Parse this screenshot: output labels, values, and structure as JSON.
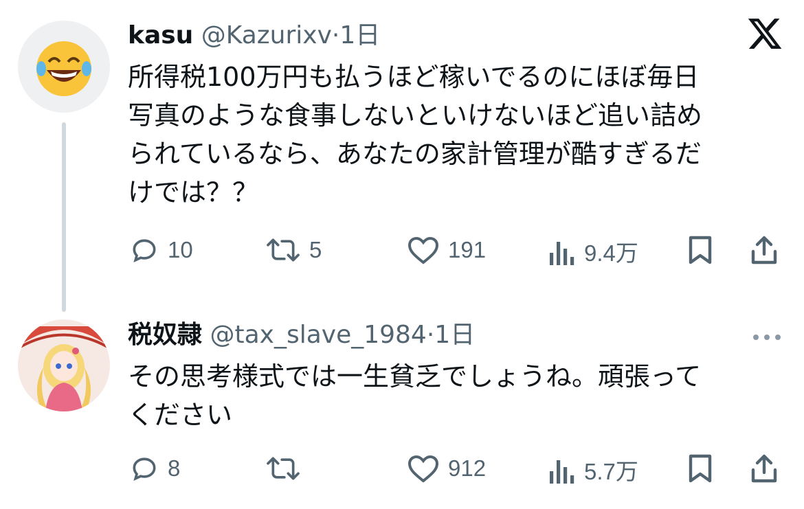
{
  "tweets": [
    {
      "display_name": "kasu",
      "handle": "@Kazurixv",
      "separator": "·",
      "time": "1日",
      "avatar_icon": "face-with-tears-of-joy-emoji-icon",
      "text": "所得税100万円も払うほど稼いでるのにほぼ毎日\n写真のような食事しないといけないほど追い詰め\nられているなら、あなたの家計管理が酷すぎるだ\nけでは？？",
      "actions": {
        "replies": "10",
        "reposts": "5",
        "likes": "191",
        "views": "9.4万"
      }
    },
    {
      "display_name": "税奴隷",
      "handle": "@tax_slave_1984",
      "separator": "·",
      "time": "1日",
      "avatar_icon": "anime-girl-kimono-umbrella-avatar-icon",
      "text": "その思考様式では一生貧乏でしょうね。頑張って\nください",
      "actions": {
        "replies": "8",
        "reposts": "",
        "likes": "912",
        "views": "5.7万"
      }
    }
  ],
  "colors": {
    "text": "#0f1419",
    "secondary": "#536471",
    "thread_line": "#cfd9de"
  }
}
